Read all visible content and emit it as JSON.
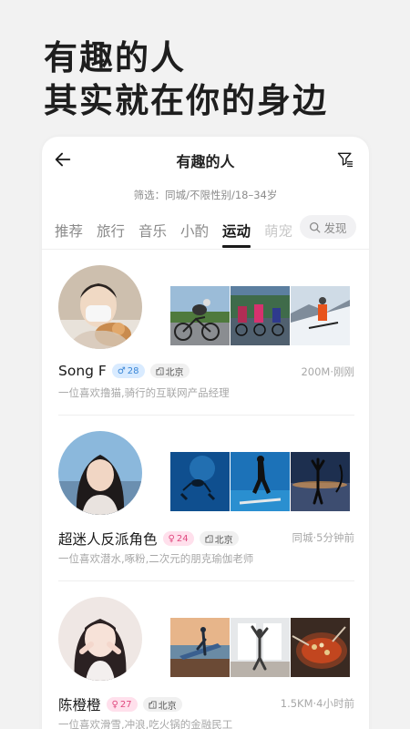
{
  "headline": {
    "line1": "有趣的人",
    "line2": "其实就在你的身边"
  },
  "header": {
    "title": "有趣的人",
    "back_icon": "arrow-left-icon",
    "filter_icon": "filter-icon"
  },
  "filter_summary": "筛选：同城/不限性别/18–34岁",
  "tabs": [
    {
      "label": "推荐",
      "active": false
    },
    {
      "label": "旅行",
      "active": false
    },
    {
      "label": "音乐",
      "active": false
    },
    {
      "label": "小酌",
      "active": false
    },
    {
      "label": "运动",
      "active": true
    },
    {
      "label": "萌宠",
      "active": false
    }
  ],
  "search": {
    "label": "发现",
    "icon": "search-icon"
  },
  "colors": {
    "male_badge": "#3a86d6",
    "female_badge": "#e0497f",
    "accent": "#1a1a1a"
  },
  "users": [
    {
      "name": "Song F",
      "gender": "male",
      "gender_symbol": "♂",
      "age": "28",
      "city": "北京",
      "meta": "200M·刚刚",
      "bio": "一位喜欢撸猫,骑行的互联网产品经理",
      "photos": [
        "cycling-photo",
        "cycling-race-photo",
        "skiing-photo"
      ]
    },
    {
      "name": "超迷人反派角色",
      "gender": "female",
      "gender_symbol": "♀",
      "age": "24",
      "city": "北京",
      "meta": "同城·5分钟前",
      "bio": "一位喜欢潜水,啄粉,二次元的朋克瑜伽老师",
      "photos": [
        "diving-photo",
        "underwater-pose-photo",
        "yoga-sunset-photo"
      ]
    },
    {
      "name": "陈橙橙",
      "gender": "female",
      "gender_symbol": "♀",
      "age": "27",
      "city": "北京",
      "meta": "1.5KM·4小时前",
      "bio": "一位喜欢滑雪,冲浪,吃火锅的金融民工",
      "photos": [
        "surfing-photo",
        "window-dance-photo",
        "hotpot-photo"
      ]
    }
  ]
}
